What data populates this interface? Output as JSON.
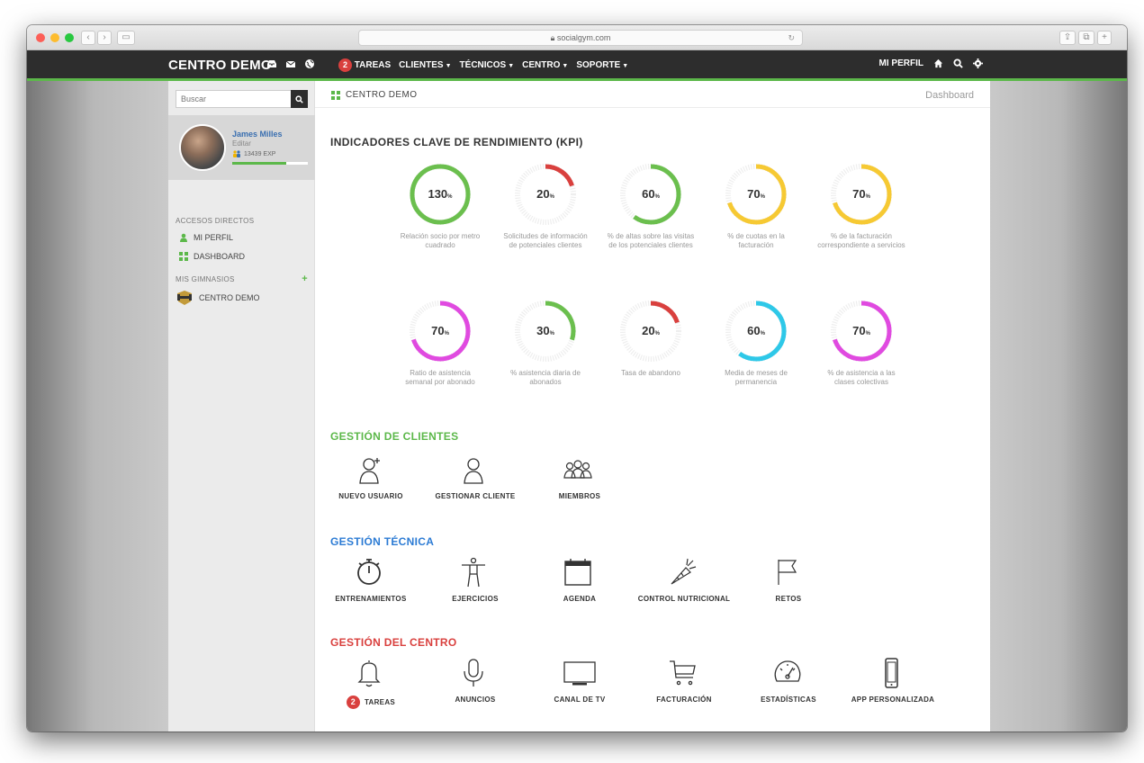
{
  "browser": {
    "url": "socialgym.com"
  },
  "nav": {
    "brand": "CENTRO DEMO",
    "tasks_badge": "2",
    "menu": [
      "TAREAS",
      "CLIENTES",
      "TÉCNICOS",
      "CENTRO",
      "SOPORTE"
    ],
    "profile": "MI PERFIL"
  },
  "sidebar": {
    "search_placeholder": "Buscar",
    "user_name": "James Milles",
    "user_edit": "Editar",
    "user_exp": "13439 EXP",
    "exp_progress": 0.72,
    "shortcuts_title": "ACCESOS DIRECTOS",
    "shortcuts": [
      "MI PERFIL",
      "DASHBOARD"
    ],
    "gyms_title": "MIS GIMNASIOS",
    "gyms": [
      "CENTRO DEMO"
    ]
  },
  "main": {
    "breadcrumb": "CENTRO DEMO",
    "breadcrumb_right": "Dashboard",
    "kpi_title": "INDICADORES CLAVE DE RENDIMIENTO (KPI)",
    "kpis": [
      {
        "value": "130",
        "unit": "%",
        "pct": 100,
        "color": "#6bbf4e",
        "label": "Relación socio por metro cuadrado"
      },
      {
        "value": "20",
        "unit": "%",
        "pct": 20,
        "color": "#d9403e",
        "label": "Solicitudes de información de potenciales clientes"
      },
      {
        "value": "60",
        "unit": "%",
        "pct": 60,
        "color": "#6bbf4e",
        "label": "% de altas sobre las visitas de los potenciales clientes"
      },
      {
        "value": "70",
        "unit": "%",
        "pct": 70,
        "color": "#f6c933",
        "label": "% de cuotas en la facturación"
      },
      {
        "value": "70",
        "unit": "%",
        "pct": 70,
        "color": "#f6c933",
        "label": "% de la facturación correspondiente a servicios"
      },
      {
        "value": "70",
        "unit": "%",
        "pct": 70,
        "color": "#e04ae0",
        "label": "Ratio de asistencia semanal por abonado"
      },
      {
        "value": "30",
        "unit": "%",
        "pct": 30,
        "color": "#6bbf4e",
        "label": "% asistencia diaria de abonados"
      },
      {
        "value": "20",
        "unit": "%",
        "pct": 20,
        "color": "#d9403e",
        "label": "Tasa de abandono"
      },
      {
        "value": "60",
        "unit": "%",
        "pct": 60,
        "color": "#2ec8e8",
        "label": "Media de meses de permanencia"
      },
      {
        "value": "70",
        "unit": "%",
        "pct": 70,
        "color": "#e04ae0",
        "label": "% de asistencia a las clases colectivas"
      }
    ],
    "groups": [
      {
        "title": "GESTIÓN DE CLIENTES",
        "color": "#5cb84a",
        "items": [
          {
            "label": "NUEVO USUARIO",
            "icon": "add-user-icon"
          },
          {
            "label": "GESTIONAR CLIENTE",
            "icon": "user-icon"
          },
          {
            "label": "MIEMBROS",
            "icon": "members-icon"
          }
        ]
      },
      {
        "title": "GESTIÓN TÉCNICA",
        "color": "#2c7bd4",
        "items": [
          {
            "label": "ENTRENAMIENTOS",
            "icon": "stopwatch-icon"
          },
          {
            "label": "EJERCICIOS",
            "icon": "exercise-icon"
          },
          {
            "label": "AGENDA",
            "icon": "calendar-icon"
          },
          {
            "label": "CONTROL NUTRICIONAL",
            "icon": "carrot-icon"
          },
          {
            "label": "RETOS",
            "icon": "flag-icon"
          }
        ]
      },
      {
        "title": "GESTIÓN DEL CENTRO",
        "color": "#d9403e",
        "items": [
          {
            "label": "TAREAS",
            "icon": "bell-icon",
            "badge": "2"
          },
          {
            "label": "ANUNCIOS",
            "icon": "microphone-icon"
          },
          {
            "label": "CANAL DE TV",
            "icon": "tv-icon"
          },
          {
            "label": "FACTURACIÓN",
            "icon": "cart-icon"
          },
          {
            "label": "ESTADÍSTICAS",
            "icon": "gauge-icon"
          },
          {
            "label": "APP PERSONALIZADA",
            "icon": "smartphone-icon"
          }
        ]
      }
    ]
  }
}
